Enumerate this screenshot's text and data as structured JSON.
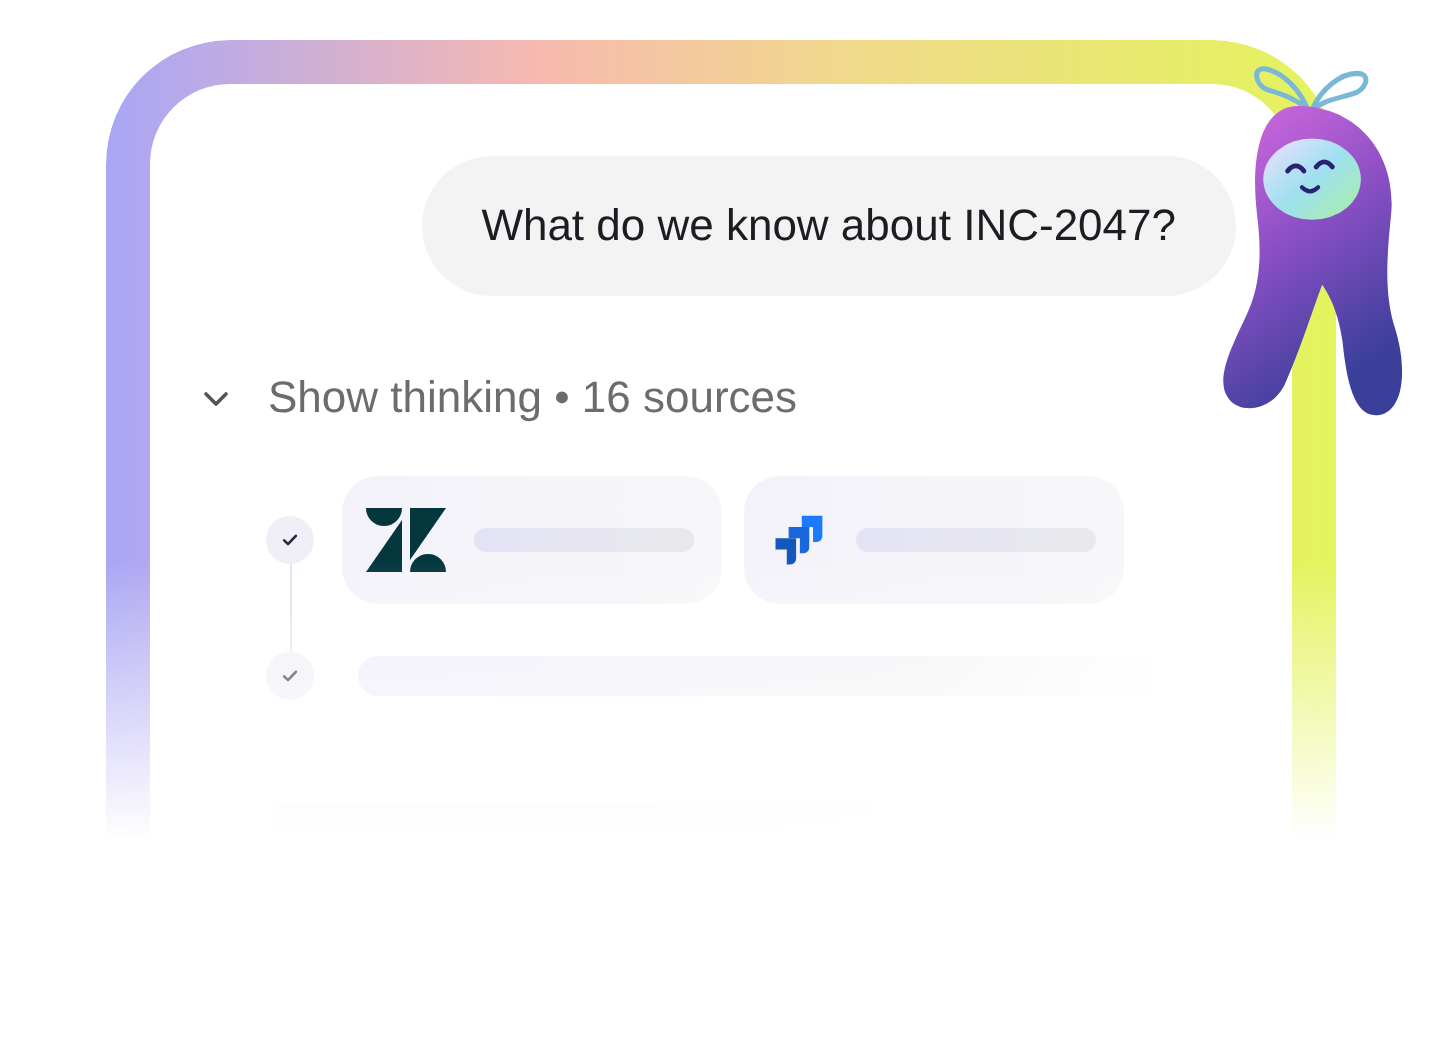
{
  "question": "What do we know about INC-2047?",
  "thinking": {
    "label": "Show thinking • 16 sources",
    "expanded": true
  },
  "steps": [
    {
      "kind": "sources",
      "done": true,
      "sources": [
        {
          "kind": "zendesk"
        },
        {
          "kind": "jira"
        }
      ]
    },
    {
      "kind": "line",
      "done": true
    }
  ]
}
